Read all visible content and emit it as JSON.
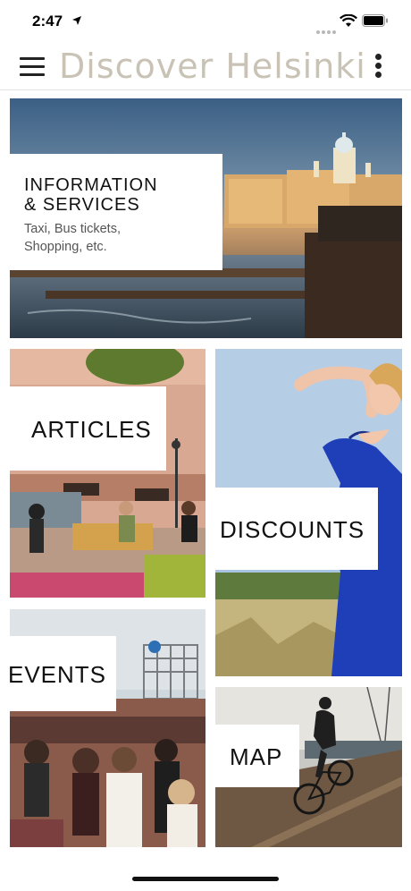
{
  "status": {
    "time": "2:47"
  },
  "header": {
    "title": "Discover Helsinki"
  },
  "tiles": {
    "info": {
      "title_line1": "INFORMATION",
      "title_line2": "& SERVICES",
      "subtitle_line1": "Taxi, Bus tickets,",
      "subtitle_line2": "Shopping, etc."
    },
    "articles": {
      "title": "ARTICLES"
    },
    "discounts": {
      "title": "DISCOUNTS"
    },
    "events": {
      "title": "EVENTS"
    },
    "map": {
      "title": "MAP"
    }
  },
  "icons": [
    "location-arrow-icon",
    "signal-icon",
    "wifi-icon",
    "battery-icon",
    "menu-icon",
    "more-vertical-icon"
  ],
  "colors": {
    "title": "#c9c3b6",
    "label_bg": "#ffffff",
    "discounts_dress": "#1f3fb8"
  }
}
